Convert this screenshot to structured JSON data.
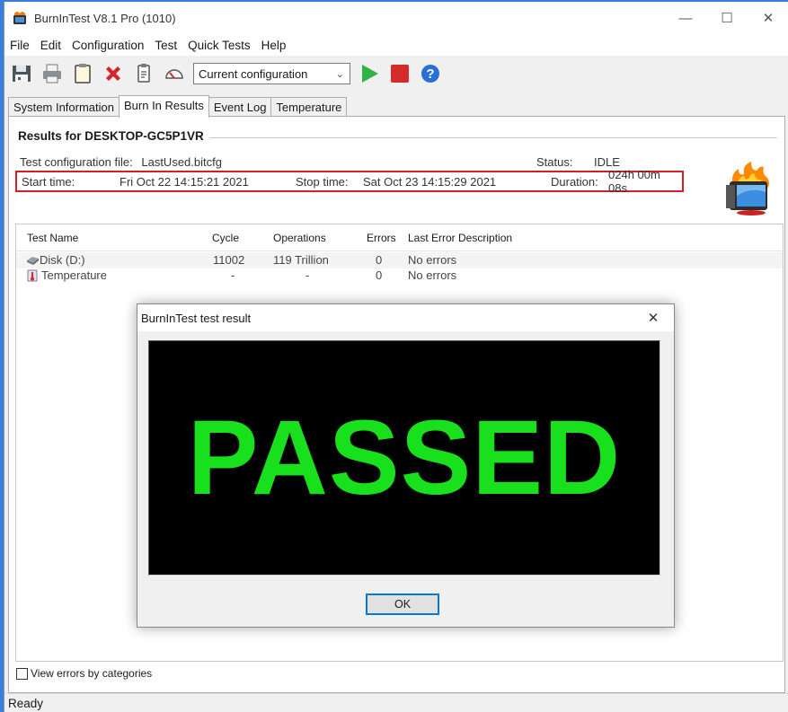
{
  "window": {
    "title": "BurnInTest V8.1 Pro (1010)",
    "minimize": "—",
    "maximize": "☐",
    "close": "✕"
  },
  "menu": [
    "File",
    "Edit",
    "Configuration",
    "Test",
    "Quick Tests",
    "Help"
  ],
  "toolbar": {
    "config_select_value": "Current configuration",
    "icons": [
      "save-icon",
      "printer-icon",
      "clipboard-icon",
      "delete-icon",
      "report-icon",
      "gauge-icon",
      "play-icon",
      "stop-icon",
      "help-icon"
    ],
    "colors": {
      "play": "#2fb344",
      "stop": "#d42b2b",
      "help": "#2a6fd6"
    }
  },
  "tabs": [
    {
      "label": "System Information",
      "active": false
    },
    {
      "label": "Burn In Results",
      "active": true
    },
    {
      "label": "Event Log",
      "active": false
    },
    {
      "label": "Temperature",
      "active": false
    }
  ],
  "results": {
    "header": "Results for DESKTOP-GC5P1VR",
    "config_label": "Test configuration file:",
    "config_value": "LastUsed.bitcfg",
    "status_label": "Status:",
    "status_value": "IDLE",
    "start_label": "Start time:",
    "start_value": "Fri Oct 22 14:15:21 2021",
    "stop_label": "Stop time:",
    "stop_value": "Sat Oct 23 14:15:29 2021",
    "duration_label": "Duration:",
    "duration_value": "024h 00m 08s"
  },
  "grid": {
    "columns": [
      "Test Name",
      "Cycle",
      "Operations",
      "Errors",
      "Last Error Description"
    ],
    "rows": [
      {
        "name": "Disk (D:)",
        "icon": "disk-icon",
        "cycle": "11002",
        "operations": "119 Trillion",
        "errors": "0",
        "last_error": "No errors"
      },
      {
        "name": "Temperature",
        "icon": "thermometer-icon",
        "cycle": "-",
        "operations": "-",
        "errors": "0",
        "last_error": "No errors"
      }
    ]
  },
  "footer": {
    "view_errors_label": "View errors by categories"
  },
  "statusbar": {
    "text": "Ready"
  },
  "dialog": {
    "title": "BurnInTest test result",
    "close": "✕",
    "result": "PASSED",
    "result_color": "#19e01c",
    "ok_label": "OK"
  }
}
